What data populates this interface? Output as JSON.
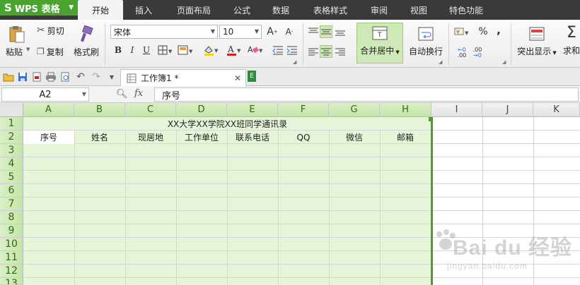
{
  "app": {
    "logo": "S",
    "name": "WPS 表格"
  },
  "menu_tabs": [
    "开始",
    "插入",
    "页面布局",
    "公式",
    "数据",
    "表格样式",
    "审阅",
    "视图",
    "特色功能"
  ],
  "ribbon": {
    "paste": "粘贴",
    "cut": "剪切",
    "copy": "复制",
    "format_painter": "格式刷",
    "font_name": "宋体",
    "font_size": "10",
    "bold": "B",
    "italic": "I",
    "underline": "U",
    "merge_center": "合并居中",
    "wrap_text": "自动换行",
    "percent": "%",
    "comma": ",",
    "inc_decimal": ".00",
    "dec_decimal": ".00",
    "highlight": "突出显示",
    "sum": "求和"
  },
  "document_tab": {
    "name": "工作簿1 *"
  },
  "formula_bar": {
    "cell_ref": "A2",
    "fx": "fx",
    "content": "序号"
  },
  "sheet": {
    "columns": [
      "A",
      "B",
      "C",
      "D",
      "E",
      "F",
      "G",
      "H",
      "I",
      "J",
      "K"
    ],
    "rows": [
      "1",
      "2",
      "3",
      "4",
      "5",
      "6",
      "7",
      "8",
      "9",
      "10",
      "11",
      "12",
      "13"
    ],
    "title": "XX大学XX学院XX班同学通讯录",
    "headers": [
      "序号",
      "姓名",
      "现居地",
      "工作单位",
      "联系电话",
      "QQ",
      "微信",
      "邮箱"
    ]
  },
  "watermark": {
    "brand": "Bai du 经验",
    "url": "jingyan.baidu.com"
  },
  "colors": {
    "accent_green": "#4ba32f",
    "selection_fill": "#e6f4d8",
    "menubar": "#3a3a3a"
  }
}
